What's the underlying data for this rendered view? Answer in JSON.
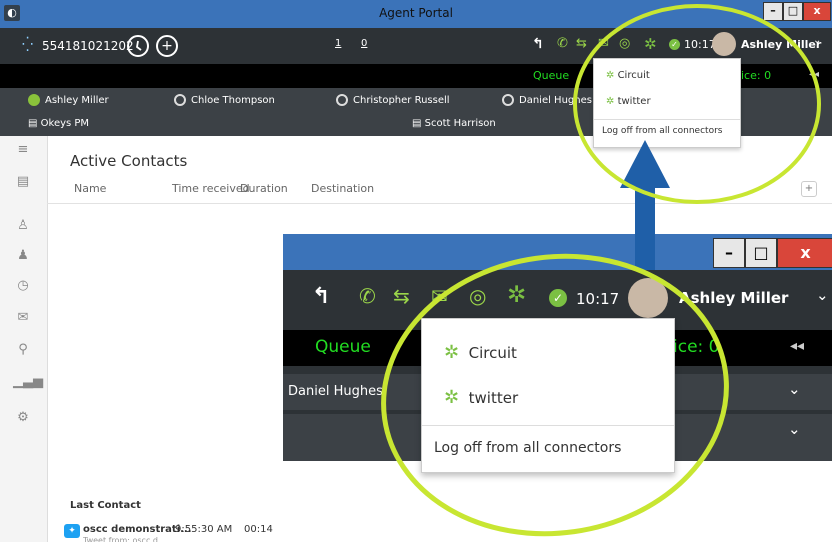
{
  "window": {
    "title": "Agent Portal",
    "minimize": "–",
    "maximize": "□",
    "close": "x"
  },
  "toolbar": {
    "phone_number": "554181021202",
    "counter_a": "1",
    "counter_b": "0",
    "time": "10:17",
    "user_name": "Ashley Miller",
    "user_chevron": "⌄"
  },
  "ticker": {
    "queue_label": "Queue",
    "voice_text": "ice:  0",
    "rewind": "◂◂"
  },
  "agents": [
    {
      "name": "Ashley Miller",
      "status": "available"
    },
    {
      "name": "Chloe Thompson",
      "status": "offline"
    },
    {
      "name": "Christopher Russell",
      "status": "offline"
    },
    {
      "name": "Daniel Hughes",
      "status": "offline"
    }
  ],
  "groups": [
    {
      "name": "Okeys PM"
    },
    {
      "name": "Scott Harrison"
    }
  ],
  "sidebar": {
    "items": [
      {
        "icon": "list-icon"
      },
      {
        "icon": "contacts-icon"
      },
      {
        "icon": "user-icon"
      },
      {
        "icon": "team-icon"
      },
      {
        "icon": "clock-icon"
      },
      {
        "icon": "mail-icon"
      },
      {
        "icon": "search-icon"
      },
      {
        "icon": "stats-icon"
      },
      {
        "icon": "settings-icon"
      }
    ]
  },
  "active_contacts": {
    "title": "Active Contacts",
    "columns": [
      "Name",
      "Time received",
      "Duration",
      "Destination"
    ],
    "add_button": "+"
  },
  "last_contact": {
    "title": "Last Contact",
    "name": "oscc demonstrati...",
    "sub": "Tweet from: oscc d...",
    "time": "9:55:30 AM",
    "duration": "00:14"
  },
  "connectors_menu": {
    "items": [
      {
        "label": "Circuit"
      },
      {
        "label": "twitter"
      }
    ],
    "logoff": "Log off from all connectors"
  },
  "zoom": {
    "queue_label": "Queue",
    "voice_text": "ice:  0",
    "rewind": "◂◂",
    "agent_name": "Daniel Hughes",
    "time": "10:17",
    "user_name": "Ashley Miller",
    "chevron": "⌄"
  },
  "colors": {
    "accent": "#3b73b9",
    "toolbar": "#2d3236",
    "highlight": "#c8e632",
    "arrow": "#1f5fa8",
    "connector_green": "#7bc043"
  }
}
